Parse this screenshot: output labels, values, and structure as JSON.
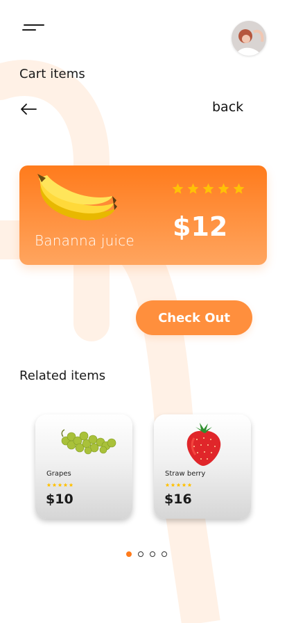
{
  "header": {
    "title": "Cart items",
    "back_label": "back"
  },
  "cart_item": {
    "name": "Bananna juice",
    "price": "$12",
    "rating": 5
  },
  "checkout_label": "Check Out",
  "related": {
    "title": "Related items",
    "items": [
      {
        "name": "Grapes",
        "price": "$10",
        "rating": 5
      },
      {
        "name": "Straw berry",
        "price": "$16",
        "rating": 5
      }
    ]
  },
  "pagination": {
    "current": 1,
    "total": 4
  },
  "colors": {
    "accent": "#ff7b1c",
    "accent_light": "#ffa55f",
    "star": "#ffc107",
    "background_shape": "#fff0e4"
  }
}
